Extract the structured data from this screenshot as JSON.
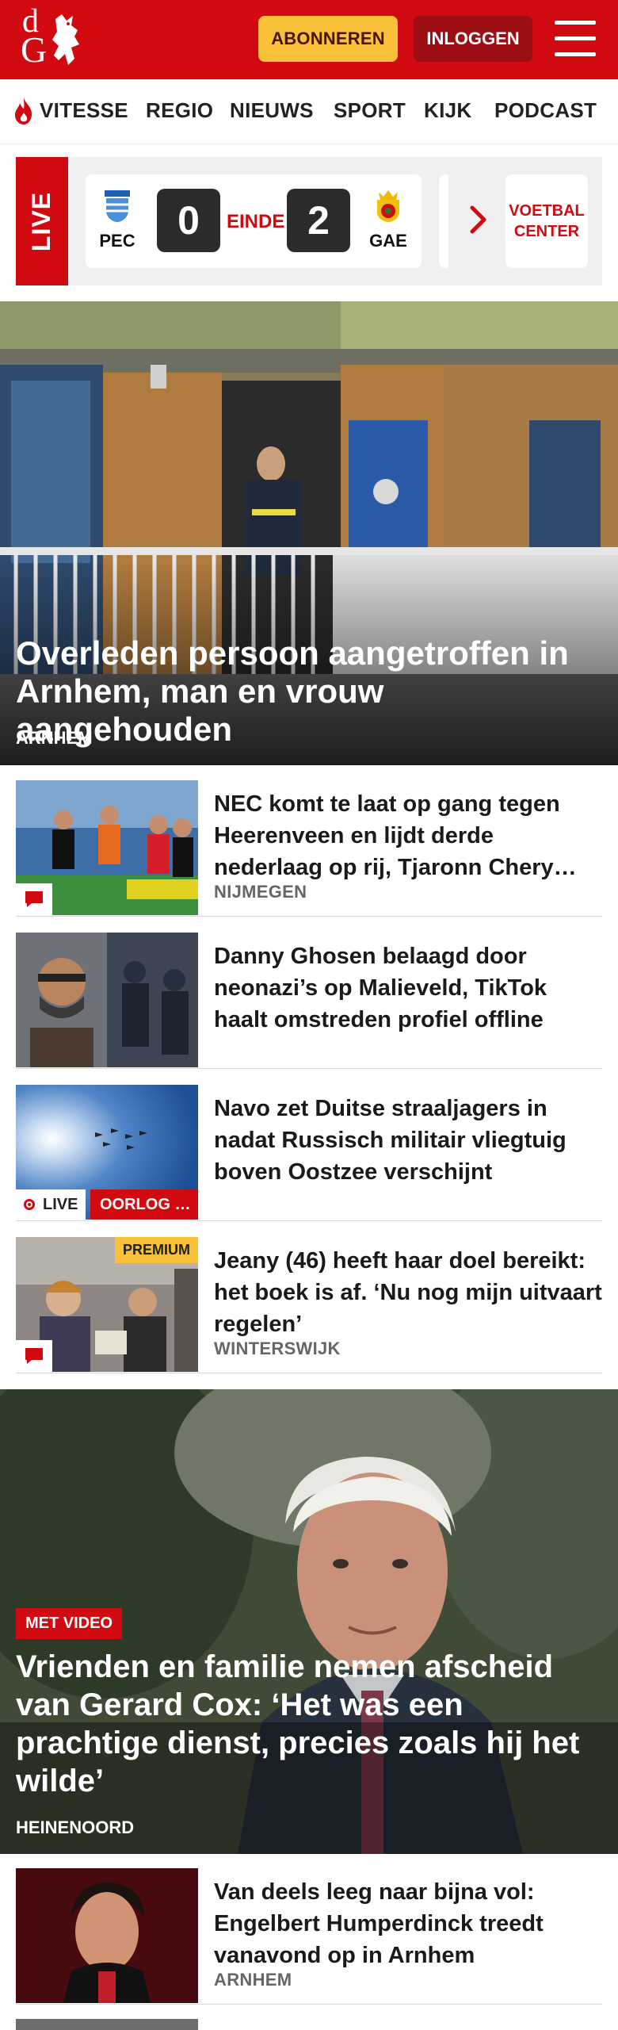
{
  "header": {
    "logo_text_top": "d",
    "logo_text_bottom": "G",
    "subscribe_label": "ABONNEREN",
    "login_label": "INLOGGEN",
    "brand_color": "#d10a11",
    "subscribe_color": "#f9c13a"
  },
  "nav": {
    "items": [
      "VITESSE",
      "REGIO",
      "NIEUWS",
      "SPORT",
      "KIJK",
      "PODCAST"
    ]
  },
  "live_widget": {
    "tab_label": "LIVE",
    "home_team": "PEC",
    "away_team": "GAE",
    "home_score": "0",
    "away_score": "2",
    "status": "EINDE",
    "football_center_label": "VOETBAL CENTER"
  },
  "hero1": {
    "title": "Overleden persoon aangetroffen in Arnhem, man en vrouw aangehouden",
    "tag": "ARNHEM"
  },
  "articles": [
    {
      "title": "NEC komt te laat op gang tegen Heerenveen en lijdt derde nederlaag op rij, Tjaronn Chery…",
      "tag": "NIJMEGEN",
      "icon": "comment-icon"
    },
    {
      "title": "Danny Ghosen belaagd door neonazi’s op Malieveld, TikTok haalt omstreden profiel offline",
      "tag": ""
    },
    {
      "title": "Navo zet Duitse straaljagers in nadat Russisch militair vliegtuig boven Oostzee verschijnt",
      "tag": "",
      "live_label": "LIVE",
      "category_label": "OORLOG …"
    },
    {
      "title": "Jeany (46) heeft haar doel bereikt: het boek is af. ‘Nu nog mijn uitvaart regelen’",
      "tag": "WINTERSWIJK",
      "premium_label": "PREMIUM",
      "icon": "comment-icon"
    }
  ],
  "hero2": {
    "badge": "MET VIDEO",
    "title": "Vrienden en familie nemen afscheid van Gerard Cox: ‘Het was een prachtige dienst, precies zoals hij het wilde’",
    "tag": "HEINENOORD"
  },
  "articles2": [
    {
      "title": "Van deels leeg naar bijna vol: Engelbert Humperdinck treedt vanavond op in Arnhem",
      "tag": "ARNHEM"
    }
  ]
}
